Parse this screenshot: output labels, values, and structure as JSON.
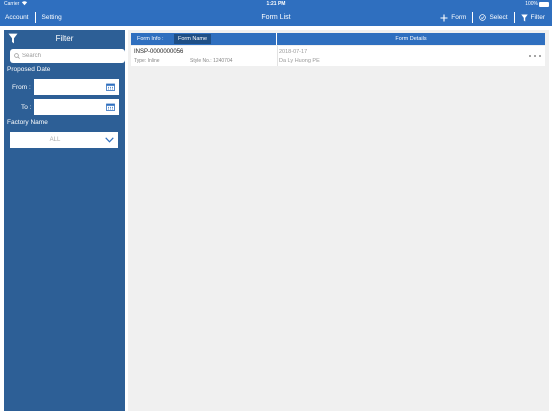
{
  "status_bar": {
    "carrier": "Carrier",
    "time": "1:21 PM",
    "battery": "100%"
  },
  "nav": {
    "account": "Account",
    "setting": "Setting",
    "title": "Form List",
    "add_form": "Form",
    "select": "Select",
    "filter": "Filter"
  },
  "sidebar": {
    "title": "Filter",
    "search_placeholder": "Search",
    "proposed_date_label": "Proposed Date",
    "from_label": "From :",
    "to_label": "To :",
    "factory_name_label": "Factory Name",
    "factory_selected": "ALL"
  },
  "table": {
    "tab_form_info": "Form Info :",
    "tab_form_name": "Form Name",
    "header_details": "Form Details",
    "rows": [
      {
        "form_no": "INSP-0000000056",
        "type": "Type: Inline",
        "style_no": "Style No.: 1240704",
        "date": "2018-07-17",
        "factory": "Da Ly Huong PE"
      }
    ]
  },
  "colors": {
    "nav_blue": "#2f6fbf",
    "sidebar_blue": "#2d5f96",
    "selected_tab": "#1f4f86"
  }
}
